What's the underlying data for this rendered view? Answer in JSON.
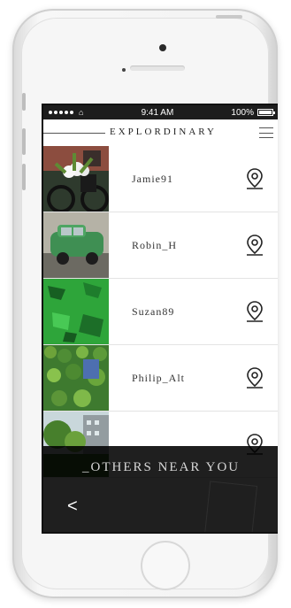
{
  "status": {
    "time": "9:41 AM",
    "battery": "100%"
  },
  "app": {
    "title": "EXPLORDINARY"
  },
  "users": [
    {
      "name": "Jamie91"
    },
    {
      "name": "Robin_H"
    },
    {
      "name": "Suzan89"
    },
    {
      "name": "Philip_Alt"
    },
    {
      "name": ""
    }
  ],
  "panel": {
    "title": "_OTHERS NEAR YOU",
    "back_label": "<"
  },
  "colors": {
    "accent": "#1d1d1d"
  },
  "icons": {
    "menu": "menu-icon",
    "pin": "location-pin-icon",
    "wifi": "wifi-icon",
    "battery": "battery-icon"
  }
}
